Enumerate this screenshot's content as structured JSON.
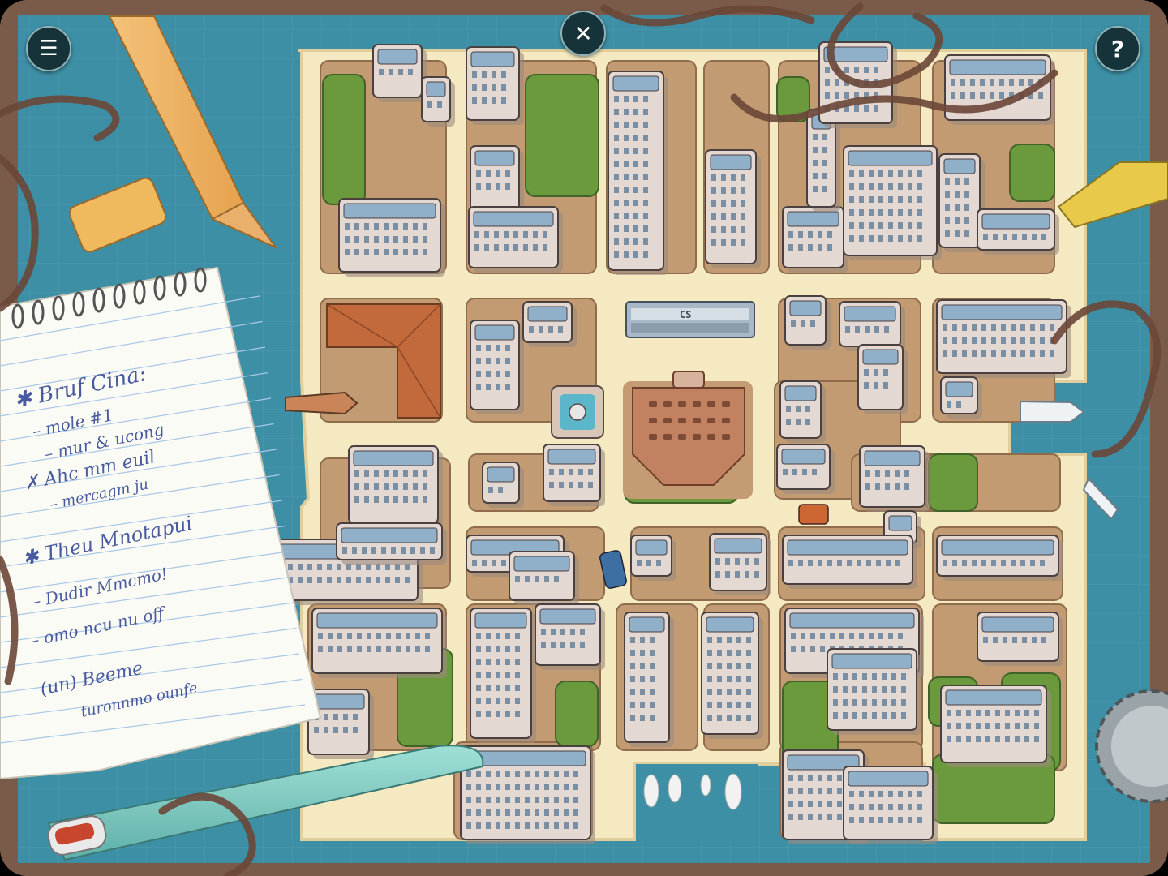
{
  "hud": {
    "menu_icon": "☰",
    "close_icon": "✕",
    "help_icon": "?"
  },
  "map": {
    "station_label": "CS",
    "colors": {
      "water": "#3d8fa5",
      "street": "#f4e9c1",
      "block": "#c39b72",
      "park": "#6b9a3c",
      "building": "#e3d8d2",
      "roof_brick": "#c26a3c",
      "frame_wood": "#7a5a48"
    }
  },
  "notepad": {
    "lines": [
      "✱ Bruf Cina:",
      "– mole #1",
      "– mur & ucong",
      "✗ Ahc mm euil",
      "– mercagm ju",
      "✱ Theu Mnotapui",
      "– Dudir Mmcmo!",
      "– omo ncu nu off",
      "(un) Beeme",
      "turonnmo ounfe"
    ]
  }
}
